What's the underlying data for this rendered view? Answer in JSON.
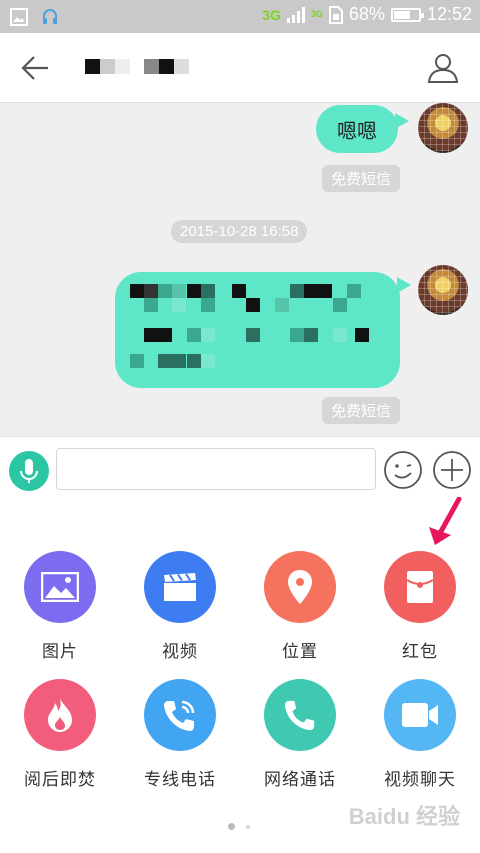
{
  "status_bar": {
    "network_primary": "3G",
    "network_secondary": "3G",
    "battery": "68%",
    "battery_level": 0.68,
    "time": "12:52"
  },
  "header": {
    "back_icon": "arrow-left-icon",
    "contact_name_redacted": true,
    "profile_icon": "person-icon"
  },
  "chat": {
    "messages": [
      {
        "direction": "outgoing",
        "text": "嗯嗯",
        "tag": "免费短信"
      },
      {
        "direction": "outgoing",
        "text_redacted": true,
        "tag": "免费短信"
      }
    ],
    "timestamp": "2015-10-28 16:58"
  },
  "input_bar": {
    "voice_icon": "microphone-icon",
    "text_value": "",
    "emoji_icon": "smiley-icon",
    "more_icon": "plus-icon"
  },
  "panel": {
    "items": [
      {
        "label": "图片",
        "icon": "image-icon",
        "color": "#7b6cf0"
      },
      {
        "label": "视频",
        "icon": "clapperboard-icon",
        "color": "#3e7cf2"
      },
      {
        "label": "位置",
        "icon": "location-pin-icon",
        "color": "#f5735e"
      },
      {
        "label": "红包",
        "icon": "red-envelope-icon",
        "color": "#f1605f"
      },
      {
        "label": "阅后即焚",
        "icon": "flame-icon",
        "color": "#f15d7a"
      },
      {
        "label": "专线电话",
        "icon": "wifi-phone-icon",
        "color": "#42a5f2"
      },
      {
        "label": "网络通话",
        "icon": "phone-icon",
        "color": "#3fc9b1"
      },
      {
        "label": "视频聊天",
        "icon": "video-camera-icon",
        "color": "#54b6f2"
      }
    ],
    "page_count": 2,
    "current_page": 1
  },
  "watermark": "Baidu 经验"
}
